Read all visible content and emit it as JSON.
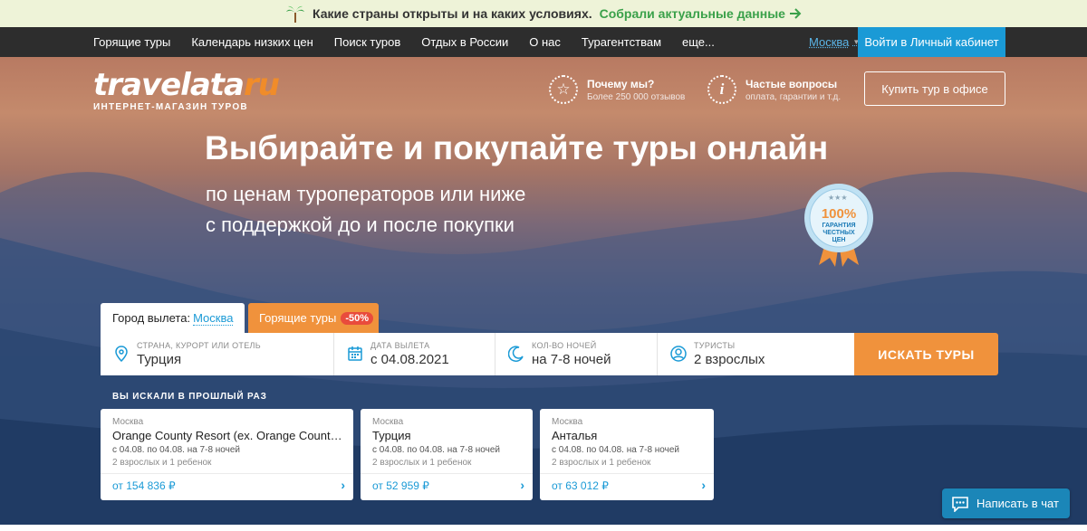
{
  "banner": {
    "text": "Какие страны открыты и на каких условиях.",
    "link": "Собрали актуальные данные"
  },
  "nav": {
    "items": [
      "Горящие туры",
      "Календарь низких цен",
      "Поиск туров",
      "Отдых в России",
      "О нас",
      "Турагентствам",
      "еще..."
    ],
    "city": "Москва",
    "login": "Войти в Личный кабинет"
  },
  "logo": {
    "word_main": "travelata",
    "word_ru": "ru",
    "tagline": "ИНТЕРНЕТ-МАГАЗИН ТУРОВ"
  },
  "header_links": {
    "why_title": "Почему мы?",
    "why_sub": "Более 250 000 отзывов",
    "faq_title": "Частые вопросы",
    "faq_sub": "оплата, гарантии и т.д.",
    "office_button": "Купить тур в офисе"
  },
  "hero": {
    "headline": "Выбирайте и покупайте туры онлайн",
    "sub1": "по ценам туроператоров или ниже",
    "sub2": "с поддержкой до и после покупки",
    "seal_pct": "100%",
    "seal_l1": "ГАРАНТИЯ",
    "seal_l2": "ЧЕСТНЫХ",
    "seal_l3": "ЦЕН"
  },
  "search": {
    "tab_city_label": "Город вылета:",
    "tab_city_value": "Москва",
    "tab_hot_label": "Горящие туры",
    "tab_hot_badge": "-50%",
    "fields": [
      {
        "label": "СТРАНА, КУРОРТ ИЛИ ОТЕЛЬ",
        "value": "Турция"
      },
      {
        "label": "ДАТА ВЫЛЕТА",
        "value": "с 04.08.2021"
      },
      {
        "label": "КОЛ-ВО НОЧЕЙ",
        "value": "на 7-8 ночей"
      },
      {
        "label": "ТУРИСТЫ",
        "value": "2 взрослых"
      }
    ],
    "button": "ИСКАТЬ ТУРЫ"
  },
  "recent": {
    "title": "ВЫ ИСКАЛИ В ПРОШЛЫЙ РАЗ",
    "cards": [
      {
        "city": "Москва",
        "dest": "Orange County Resort (ex. Orange County Del...",
        "dates": "с 04.08. по 04.08. на 7-8 ночей",
        "pax": "2 взрослых и 1 ребенок",
        "price": "от 154 836 ₽"
      },
      {
        "city": "Москва",
        "dest": "Турция",
        "dates": "с 04.08. по 04.08. на 7-8 ночей",
        "pax": "2 взрослых и 1 ребенок",
        "price": "от 52 959 ₽"
      },
      {
        "city": "Москва",
        "dest": "Анталья",
        "dates": "с 04.08. по 04.08. на 7-8 ночей",
        "pax": "2 взрослых и 1 ребенок",
        "price": "от 63 012 ₽"
      }
    ]
  },
  "chat": {
    "label": "Написать в чат"
  },
  "colors": {
    "accent_orange": "#f0923c",
    "brand_blue": "#1a9ad6",
    "badge_red": "#e94b3c",
    "banner_green": "#3aa14a"
  },
  "icons": [
    "palm-icon",
    "arrow-right-icon",
    "star-icon",
    "info-icon",
    "location-pin-icon",
    "calendar-icon",
    "moon-icon",
    "user-icon",
    "chevron-right-icon",
    "chat-icon"
  ]
}
